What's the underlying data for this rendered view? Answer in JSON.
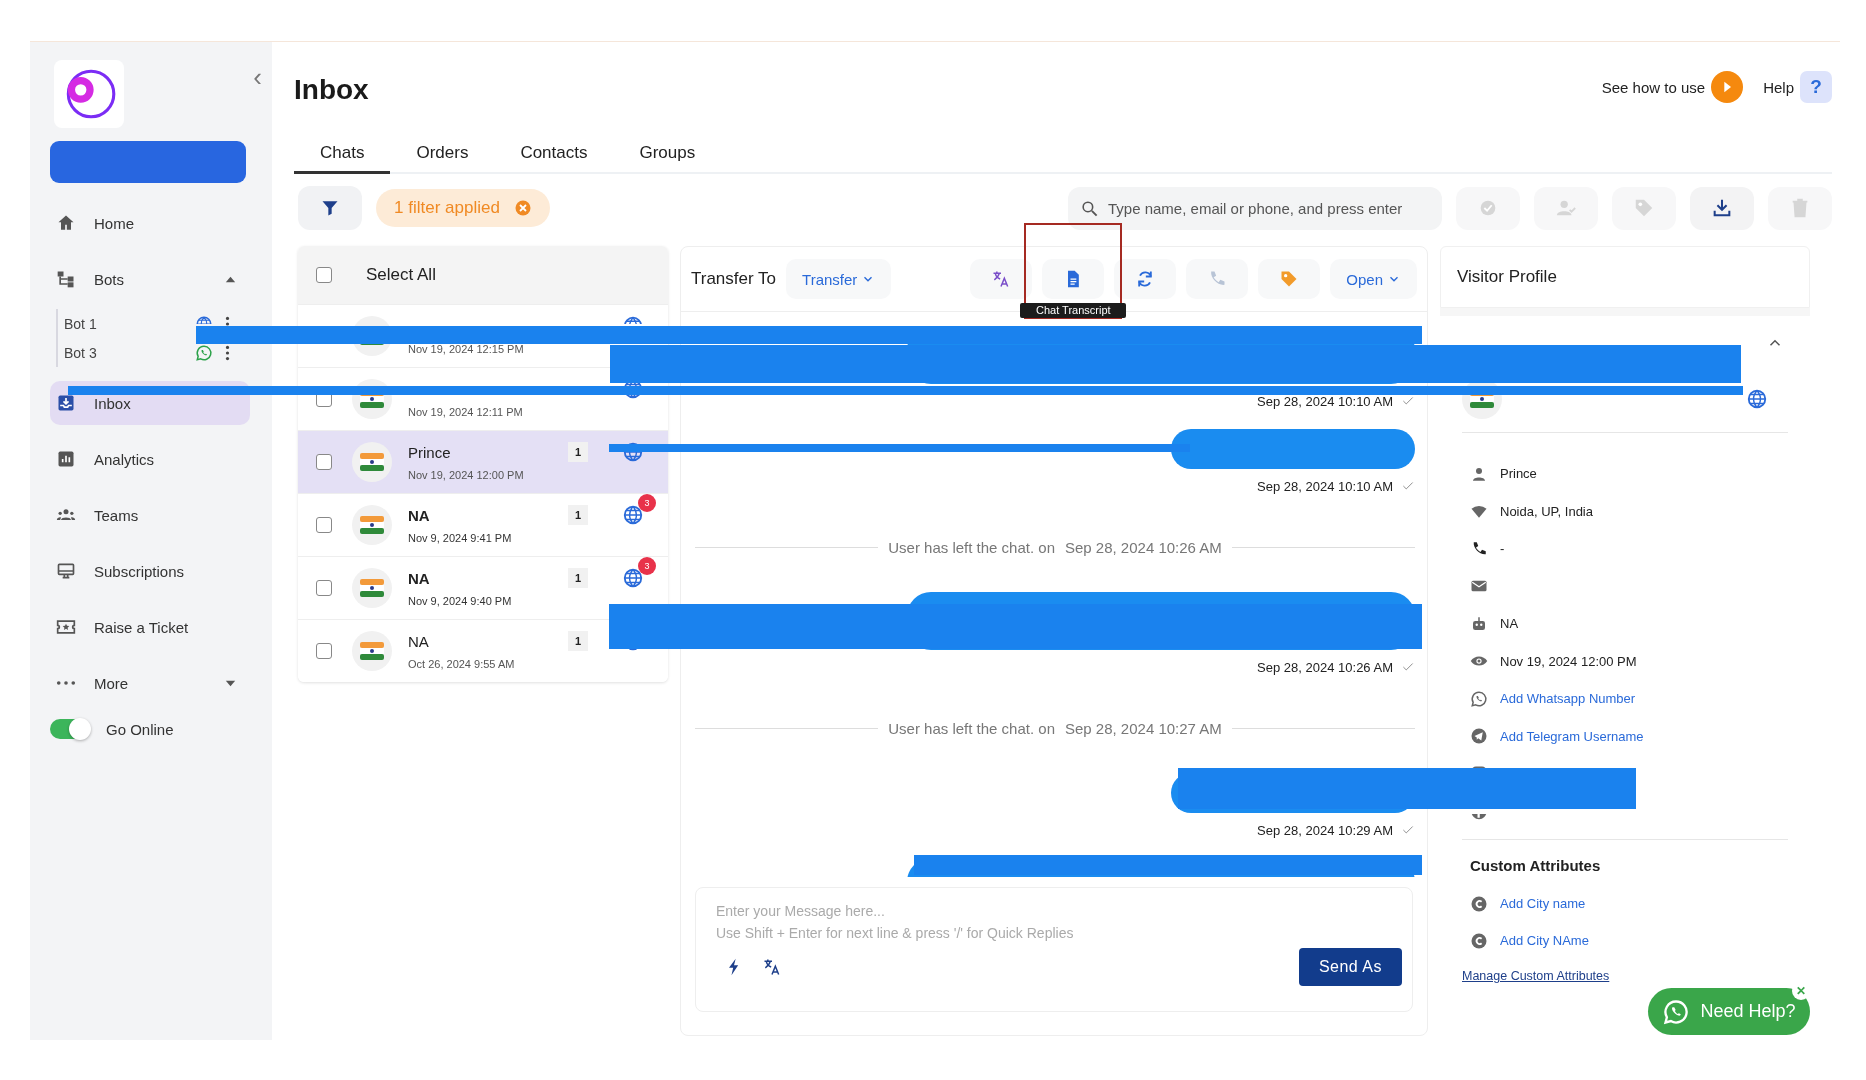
{
  "sidebar": {
    "collapse": "‹",
    "items": [
      {
        "kind": "link",
        "label": "Home",
        "selected": false
      },
      {
        "kind": "group",
        "label": "Bots",
        "expanded": true,
        "selected": false,
        "children": [
          {
            "label": "Bot 1"
          },
          {
            "label": "Bot 3"
          }
        ]
      },
      {
        "kind": "link",
        "label": "Inbox",
        "selected": true
      },
      {
        "kind": "link",
        "label": "Analytics",
        "selected": false
      },
      {
        "kind": "link",
        "label": "Teams",
        "selected": false
      },
      {
        "kind": "link",
        "label": "Subscriptions",
        "selected": false
      },
      {
        "kind": "link",
        "label": "Raise a Ticket",
        "selected": false
      },
      {
        "kind": "group",
        "label": "More",
        "expanded": false,
        "selected": false
      }
    ],
    "online": {
      "label": "Go Online",
      "on": true
    }
  },
  "header": {
    "title": "Inbox",
    "how_to": "See how to use",
    "help": "Help",
    "help_mark": "?"
  },
  "tabs": [
    {
      "label": "Chats",
      "selected": true
    },
    {
      "label": "Orders",
      "selected": false
    },
    {
      "label": "Contacts",
      "selected": false
    },
    {
      "label": "Groups",
      "selected": false
    }
  ],
  "filter": {
    "label": "1 filter applied"
  },
  "search": {
    "placeholder": "Type name, email or phone, and press enter"
  },
  "bulk_actions": [
    {
      "disabled": true
    },
    {
      "disabled": true
    },
    {
      "disabled": true
    },
    {
      "disabled": false
    },
    {
      "disabled": true
    }
  ],
  "chat_list": {
    "select_all": {
      "label": "Select All",
      "checked": false
    },
    "rows": [
      {
        "date": "Nov 19, 2024 12:15 PM",
        "selected": false
      },
      {
        "date": "Nov 19, 2024 12:11 PM",
        "selected": false,
        "checked": false
      },
      {
        "name": "Prince",
        "count": "1",
        "date": "Nov 19, 2024 12:00 PM",
        "selected": true,
        "checked": false,
        "unread": false
      },
      {
        "name": "NA",
        "count": "1",
        "date": "Nov 9, 2024 9:41 PM",
        "badge": "3",
        "selected": false,
        "checked": false,
        "unread": true
      },
      {
        "name": "NA",
        "count": "1",
        "date": "Nov 9, 2024 9:40 PM",
        "badge": "3",
        "selected": false,
        "checked": false,
        "unread": true
      },
      {
        "name": "NA",
        "count": "1",
        "date": "Oct 26, 2024 9:55 AM",
        "selected": false,
        "checked": false,
        "unread": false
      }
    ]
  },
  "chat": {
    "transfer_label": "Transfer To",
    "transfer": "Transfer",
    "status": "Open",
    "tooltip": "Chat Transcript",
    "messages": [
      {
        "kind": "longbubble"
      },
      {
        "kind": "time",
        "text": "Sep 28, 2024 10:10 AM"
      },
      {
        "kind": "shortbubble"
      },
      {
        "kind": "time",
        "text": "Sep 28, 2024 10:10 AM"
      },
      {
        "kind": "system",
        "text": "User has left the chat. on",
        "time": "Sep 28, 2024 10:26 AM"
      },
      {
        "kind": "longbubble"
      },
      {
        "kind": "time",
        "text": "Sep 28, 2024 10:26 AM"
      },
      {
        "kind": "system",
        "text": "User has left the chat. on",
        "time": "Sep 28, 2024 10:27 AM"
      },
      {
        "kind": "shortbubble"
      },
      {
        "kind": "time",
        "text": "Sep 28, 2024 10:29 AM"
      },
      {
        "kind": "longbubble"
      }
    ],
    "composer": {
      "placeholder": "Enter your Message here...\nUse Shift + Enter for next line & press '/' for Quick Replies",
      "send": "Send As"
    }
  },
  "profile": {
    "title": "Visitor Profile",
    "details": [
      {
        "text": "Prince",
        "kind": "text"
      },
      {
        "text": "Noida, UP, India",
        "kind": "text"
      },
      {
        "text": "-",
        "kind": "text"
      },
      {
        "kind": "text"
      },
      {
        "text": "NA",
        "kind": "text"
      },
      {
        "text": "Nov 19, 2024 12:00 PM",
        "kind": "text"
      },
      {
        "text": "Add Whatsapp Number",
        "kind": "link"
      },
      {
        "text": "Add Telegram Username",
        "kind": "link"
      },
      {
        "kind": "link"
      },
      {
        "kind": "link"
      }
    ],
    "custom_title": "Custom Attributes",
    "custom": [
      "Add City name",
      "Add City NAme"
    ],
    "manage": "Manage Custom Attributes"
  },
  "need_help": {
    "label": "Need Help?",
    "close": "✕"
  }
}
